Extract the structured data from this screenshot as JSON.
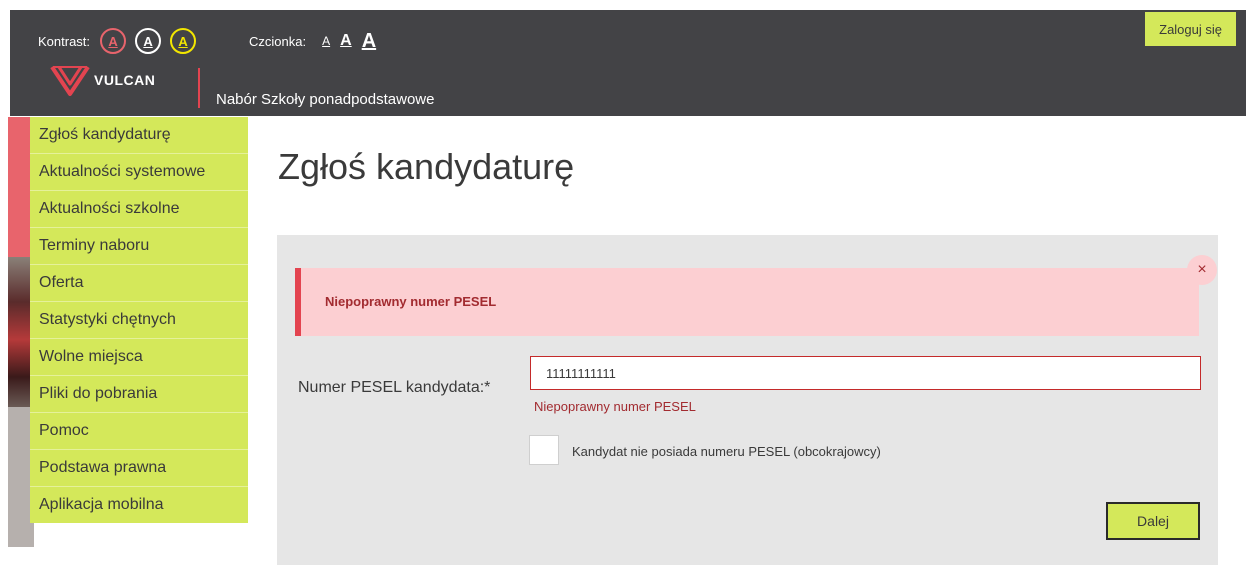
{
  "header": {
    "contrast_label": "Kontrast:",
    "contrast_buttons": [
      {
        "letter": "A",
        "color": "#e8646c"
      },
      {
        "letter": "A",
        "color": "#ffffff"
      },
      {
        "letter": "A",
        "color": "#f3e600"
      }
    ],
    "font_label": "Czcionka:",
    "font_sizes": [
      "A",
      "A",
      "A"
    ],
    "login_label": "Zaloguj się",
    "logo_text": "VULCAN",
    "system_name": "Nabór Szkoły ponadpodstawowe"
  },
  "sidebar": {
    "items": [
      {
        "label": "Zgłoś kandydaturę"
      },
      {
        "label": "Aktualności systemowe"
      },
      {
        "label": "Aktualności szkolne"
      },
      {
        "label": "Terminy naboru"
      },
      {
        "label": "Oferta"
      },
      {
        "label": "Statystyki chętnych"
      },
      {
        "label": "Wolne miejsca"
      },
      {
        "label": "Pliki do pobrania"
      },
      {
        "label": "Pomoc"
      },
      {
        "label": "Podstawa prawna"
      },
      {
        "label": "Aplikacja mobilna"
      }
    ]
  },
  "main": {
    "title": "Zgłoś kandydaturę",
    "alert": {
      "message": "Niepoprawny numer PESEL",
      "close_icon": "×"
    },
    "form": {
      "pesel_label": "Numer PESEL kandydata:*",
      "pesel_value": "11111111111",
      "pesel_error": "Niepoprawny numer PESEL",
      "no_pesel_label": "Kandydat nie posiada numeru PESEL (obcokrajowcy)",
      "no_pesel_checked": false,
      "next_label": "Dalej"
    }
  },
  "colors": {
    "accent_green": "#d4e85a",
    "header_bg": "#434346",
    "error_red": "#a22b30",
    "alert_bg": "#fccfd2",
    "brand_red": "#e34450"
  }
}
